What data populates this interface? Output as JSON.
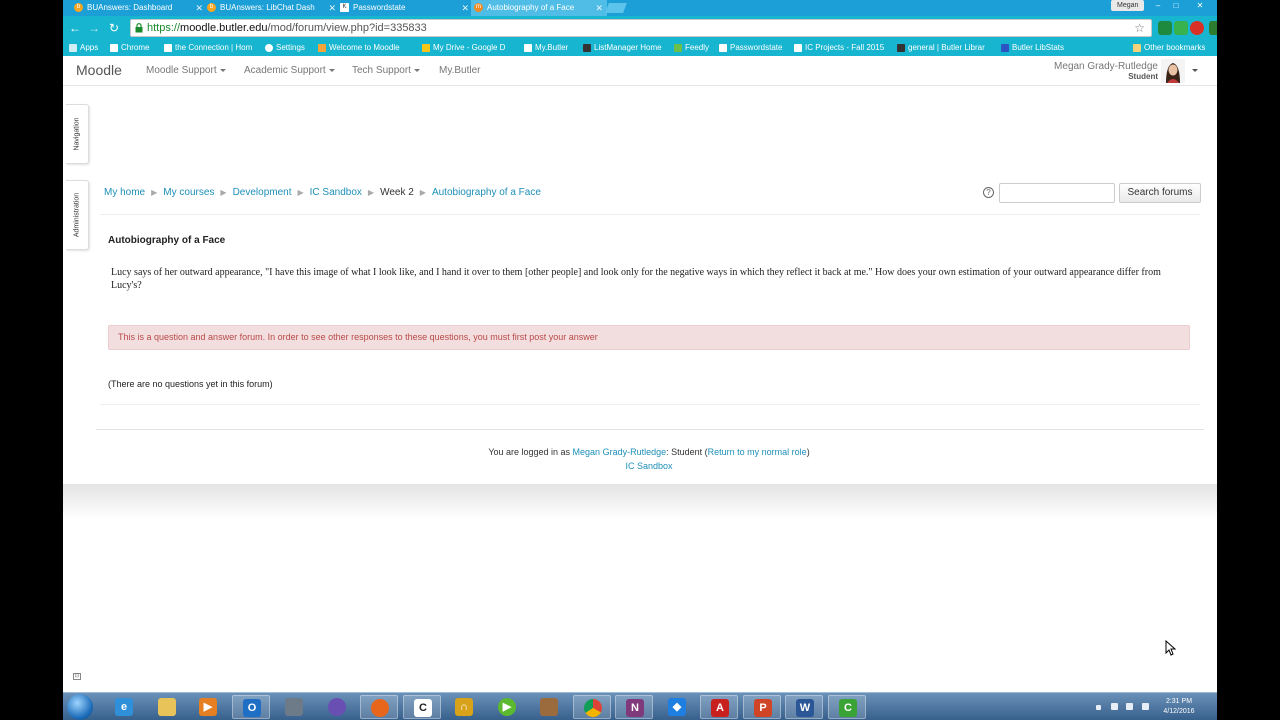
{
  "browser": {
    "tabs": [
      {
        "title": "BUAnswers: Dashboard",
        "icon": "b-icon"
      },
      {
        "title": "BUAnswers: LibChat Dash",
        "icon": "b-icon"
      },
      {
        "title": "Passwordstate",
        "icon": "k-icon"
      },
      {
        "title": "Autobiography of a Face",
        "icon": "moodle-icon"
      }
    ],
    "window_user": "Megan",
    "url_prefix": "https://",
    "url_host": "moodle.butler.edu",
    "url_path": "/mod/forum/view.php?id=335833",
    "bookmarks": [
      "Apps",
      "Chrome",
      "the Connection | Hom",
      "Settings",
      "Welcome to Moodle",
      "My Drive - Google D",
      "My.Butler",
      "ListManager Home",
      "Feedly",
      "Passwordstate",
      "IC Projects - Fall 2015",
      "general | Butler Librar",
      "Butler LibStats",
      "Other bookmarks"
    ],
    "accent": "#17b5cf"
  },
  "moodle": {
    "brand": "Moodle",
    "menus": [
      "Moodle Support",
      "Academic Support",
      "Tech Support",
      "My.Butler"
    ],
    "user_name": "Megan Grady-Rutledge",
    "user_role": "Student",
    "side_blocks": [
      "Navigation",
      "Administration"
    ],
    "breadcrumb": [
      "My home",
      "My courses",
      "Development",
      "IC Sandbox",
      "Week 2",
      "Autobiography of a Face"
    ],
    "search_button": "Search forums",
    "search_placeholder": "",
    "forum_title": "Autobiography of a Face",
    "forum_intro": "Lucy says of her outward appearance, \"I have this image of what I look like, and I hand it over to them [other people] and look only for the negative ways in which they reflect it back at me.\" How does your own estimation of your outward appearance differ from Lucy's?",
    "alert": "This is a question and answer forum. In order to see other responses to these questions, you must first post your answer",
    "no_questions": "(There are no questions yet in this forum)",
    "footer_logged_prefix": "You are logged in as ",
    "footer_user": "Megan Grady-Rutledge",
    "footer_role_text": ": Student (",
    "footer_return": "Return to my normal role",
    "footer_close": ")",
    "footer_course": "IC Sandbox"
  },
  "taskbar": {
    "time": "2:31 PM",
    "date": "4/12/2016"
  }
}
